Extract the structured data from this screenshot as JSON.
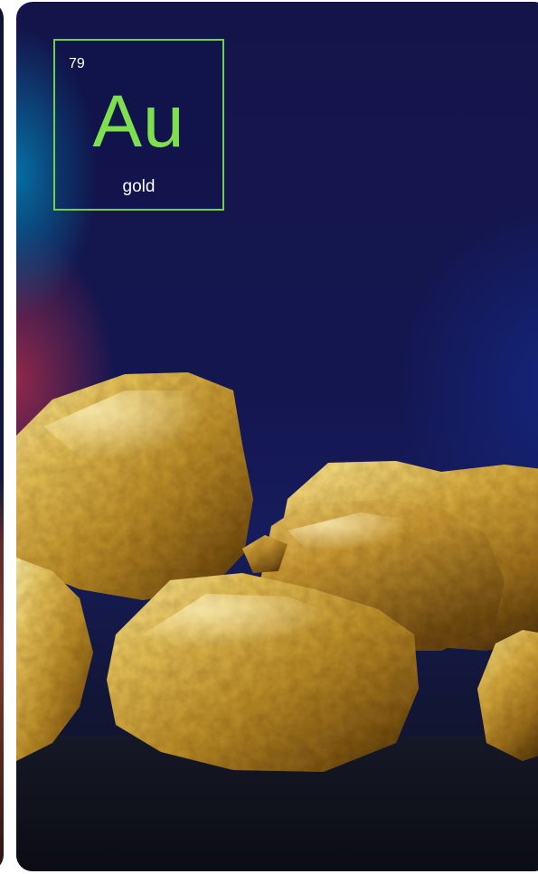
{
  "element": {
    "atomic_number": "79",
    "symbol": "Au",
    "name": "gold"
  },
  "colors": {
    "tile_border": "#6fd14a",
    "symbol": "#7ee04e",
    "background": "#13154a"
  },
  "image": {
    "subject": "gold-nuggets-photo"
  }
}
